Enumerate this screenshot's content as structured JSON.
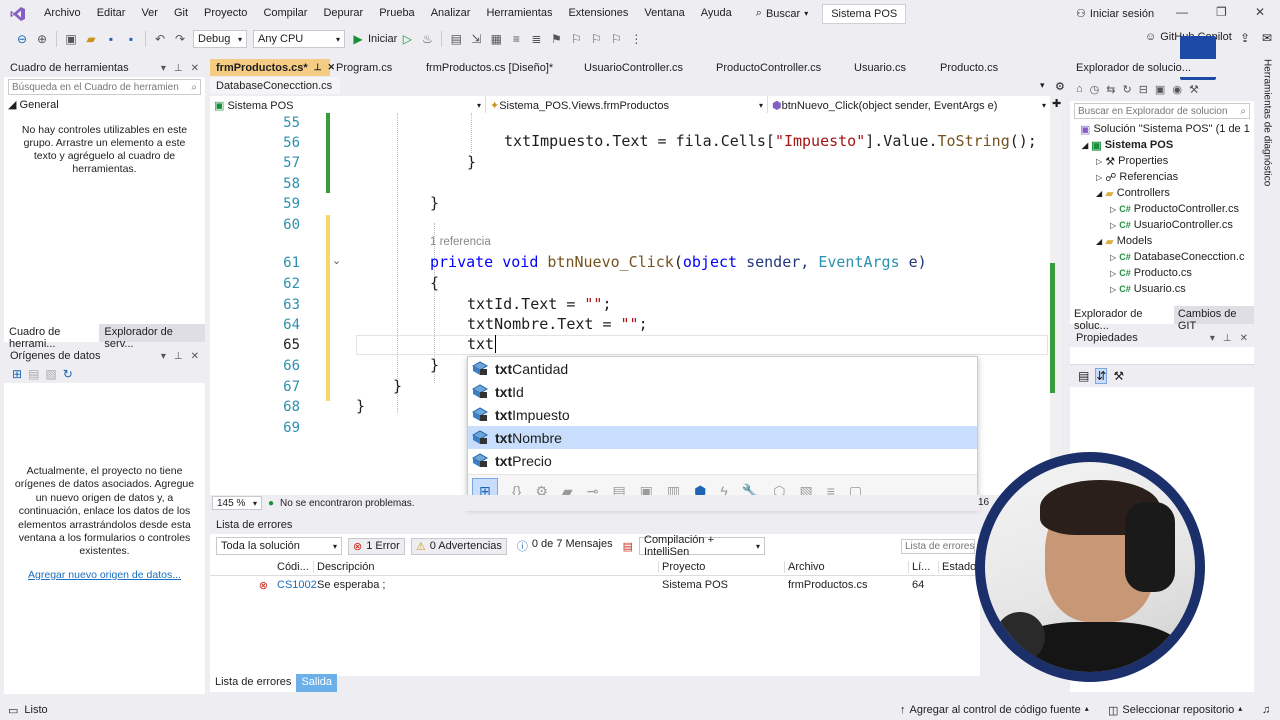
{
  "menu": {
    "items": [
      "Archivo",
      "Editar",
      "Ver",
      "Git",
      "Proyecto",
      "Compilar",
      "Depurar",
      "Prueba",
      "Analizar",
      "Herramientas",
      "Extensiones",
      "Ventana",
      "Ayuda"
    ],
    "search": "Buscar",
    "solution_title": "Sistema POS",
    "login": "Iniciar sesión"
  },
  "toolbar": {
    "config": "Debug",
    "platform": "Any CPU",
    "start": "Iniciar",
    "copilot": "GitHub Copilot"
  },
  "toolbox": {
    "title": "Cuadro de herramientas",
    "search_placeholder": "Búsqueda en el Cuadro de herramien",
    "group": "General",
    "empty": "No hay controles utilizables en este grupo. Arrastre un elemento a este texto y agréguelo al cuadro de herramientas.",
    "tabs": [
      "Cuadro de herrami...",
      "Explorador de serv..."
    ]
  },
  "datasources": {
    "title": "Orígenes de datos",
    "empty": "Actualmente, el proyecto no tiene orígenes de datos asociados. Agregue un nuevo origen de datos y, a continuación, enlace los datos de los elementos arrastrándolos desde esta ventana a los formularios o controles existentes.",
    "link": "Agregar nuevo origen de datos..."
  },
  "doc_tabs": [
    "frmProductos.cs*",
    "Program.cs",
    "frmProductos.cs [Diseño]*",
    "UsuarioController.cs",
    "ProductoController.cs",
    "Usuario.cs",
    "Producto.cs"
  ],
  "doc_tabs2": [
    "DatabaseConecction.cs"
  ],
  "nav": {
    "project": "Sistema POS",
    "class": "Sistema_POS.Views.frmProductos",
    "member": "btnNuevo_Click(object sender, EventArgs e)"
  },
  "code": {
    "line_numbers": [
      "55",
      "56",
      "57",
      "58",
      "59",
      "60",
      "61",
      "62",
      "63",
      "64",
      "65",
      "66",
      "67",
      "68",
      "69"
    ],
    "ref_lens": "1 referencia",
    "l56a": "txtImpuesto.Text = fila.Cells[",
    "l56s": "\"Impuesto\"",
    "l56b": "].Value.",
    "l56f": "ToString",
    "l56c": "();",
    "l57": "}",
    "l59": "}",
    "l61k1": "private",
    "l61k2": "void",
    "l61f": "btnNuevo_Click",
    "l61a": "(",
    "l61k3": "object",
    "l61b": " sender, ",
    "l61t": "EventArgs",
    "l61c": " e)",
    "l62": "{",
    "l63a": "txtId.Text = ",
    "l63s": "\"\"",
    "l63b": ";",
    "l64a": "txtNombre.Text = ",
    "l64s": "\"\"",
    "l64b": ";",
    "l65": "txt",
    "l66": "}",
    "l67": "}",
    "l68": "}"
  },
  "autocomplete": {
    "items": [
      {
        "bold": "txt",
        "rest": "Cantidad"
      },
      {
        "bold": "txt",
        "rest": "Id"
      },
      {
        "bold": "txt",
        "rest": "Impuesto"
      },
      {
        "bold": "txt",
        "rest": "Nombre"
      },
      {
        "bold": "txt",
        "rest": "Precio"
      }
    ],
    "selected_index": 3
  },
  "editor_status": {
    "zoom": "145 %",
    "problems": "No se encontraron problemas.",
    "col": "16"
  },
  "errors": {
    "title": "Lista de errores",
    "scope": "Toda la solución",
    "error_count": "1 Error",
    "warning_count": "0 Advertencias",
    "message_count": "0 de 7 Mensajes",
    "build": "Compilación + IntelliSen",
    "search": "Lista de errores",
    "columns": [
      "Códi...",
      "Descripción",
      "Proyecto",
      "Archivo",
      "Lí...",
      "Estado"
    ],
    "rows": [
      {
        "code": "CS1002",
        "desc": "Se esperaba ;",
        "project": "Sistema POS",
        "file": "frmProductos.cs",
        "line": "64"
      }
    ],
    "tabs": [
      "Lista de errores",
      "Salida"
    ]
  },
  "solution": {
    "title": "Explorador de solucio...",
    "search": "Buscar en Explorador de solucion",
    "root": "Solución \"Sistema POS\" (1 de 1",
    "project": "Sistema POS",
    "items": [
      "Properties",
      "Referencias",
      "Controllers",
      "ProductoController.cs",
      "UsuarioController.cs",
      "Models",
      "DatabaseConecction.c",
      "Producto.cs",
      "Usuario.cs"
    ],
    "tabs": [
      "Explorador de soluc...",
      "Cambios de GIT"
    ]
  },
  "properties": {
    "title": "Propiedades"
  },
  "side_tab": "Herramientas de diagnóstico",
  "status": {
    "ready": "Listo",
    "source": "Agregar al control de código fuente",
    "repo": "Seleccionar repositorio"
  }
}
